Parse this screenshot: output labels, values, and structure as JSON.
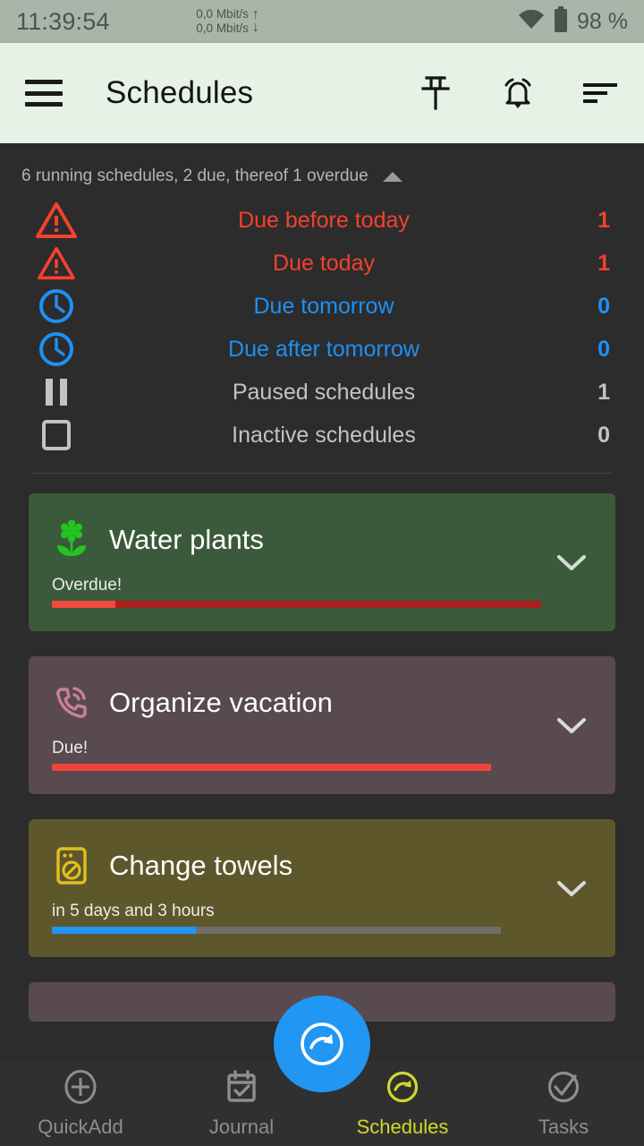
{
  "statusbar": {
    "clock": "11:39:54",
    "uplink_rate": "0,0 Mbit/s",
    "downlink_rate": "0,0 Mbit/s",
    "up_arrow": "↑",
    "down_arrow": "↓",
    "wifi_icon": "wifi-icon",
    "battery_icon": "battery-icon",
    "battery_text": "98 %"
  },
  "appbar": {
    "menu_icon": "hamburger-menu-icon",
    "title": "Schedules",
    "actions": [
      {
        "name": "pin-icon",
        "label": "Pin"
      },
      {
        "name": "alarm-bell-icon",
        "label": "Alarms"
      },
      {
        "name": "sort-icon",
        "label": "Sort"
      }
    ]
  },
  "summary": {
    "headline": "6 running schedules, 2 due, thereof 1 overdue",
    "collapse_icon": "triangle-up-icon",
    "rows": [
      {
        "icon": "warning-triangle-icon",
        "label": "Due before today",
        "value": "1",
        "color": "#f4412e"
      },
      {
        "icon": "warning-triangle-icon",
        "label": "Due today",
        "value": "1",
        "color": "#f4412e"
      },
      {
        "icon": "clock-icon",
        "label": "Due tomorrow",
        "value": "0",
        "color": "#1e90f5"
      },
      {
        "icon": "clock-icon",
        "label": "Due after tomorrow",
        "value": "0",
        "color": "#1e90f5"
      },
      {
        "icon": "pause-icon",
        "label": "Paused schedules",
        "value": "1",
        "color": "#c3c3c3"
      },
      {
        "icon": "stop-square-icon",
        "label": "Inactive schedules",
        "value": "0",
        "color": "#c3c3c3"
      }
    ]
  },
  "cards": [
    {
      "title": "Water plants",
      "status": "Overdue!",
      "icon": "flower-plant-icon",
      "icon_color": "#22c522",
      "card_color": "#3b5a3b",
      "progress_percent": 13,
      "fill_color": "#ef4a3c",
      "rest_color": "#ab1f1c",
      "bar_width_percent": 98,
      "expand_icon": "chevron-down-icon"
    },
    {
      "title": "Organize vacation",
      "status": "Due!",
      "icon": "phone-ring-icon",
      "icon_color": "#cc7f99",
      "card_color": "#584a4e",
      "progress_percent": 100,
      "fill_color": "#f0443a",
      "rest_color": "#f0443a",
      "bar_width_percent": 88,
      "expand_icon": "chevron-down-icon"
    },
    {
      "title": "Change towels",
      "status": "in 5 days and 3 hours",
      "icon": "washing-machine-icon",
      "icon_color": "#e0c020",
      "card_color": "#5e572c",
      "progress_percent": 32,
      "fill_color": "#2196f3",
      "rest_color": "#6e6e6e",
      "bar_width_percent": 90,
      "expand_icon": "chevron-down-icon"
    },
    {
      "title": "",
      "status": "",
      "icon": "",
      "icon_color": "#cc7f99",
      "card_color": "#584a4e",
      "progress_percent": 0,
      "fill_color": "#584a4e",
      "rest_color": "#584a4e",
      "bar_width_percent": 0,
      "expand_icon": ""
    }
  ],
  "fab": {
    "icon": "schedule-refresh-icon",
    "color": "#2196f3"
  },
  "bottomnav": {
    "active_color": "#d4d72a",
    "items": [
      {
        "icon": "plus-circle-icon",
        "label": "QuickAdd",
        "active": false
      },
      {
        "icon": "calendar-check-icon",
        "label": "Journal",
        "active": false
      },
      {
        "icon": "schedule-arrow-icon",
        "label": "Schedules",
        "active": true
      },
      {
        "icon": "check-circle-icon",
        "label": "Tasks",
        "active": false
      }
    ]
  }
}
